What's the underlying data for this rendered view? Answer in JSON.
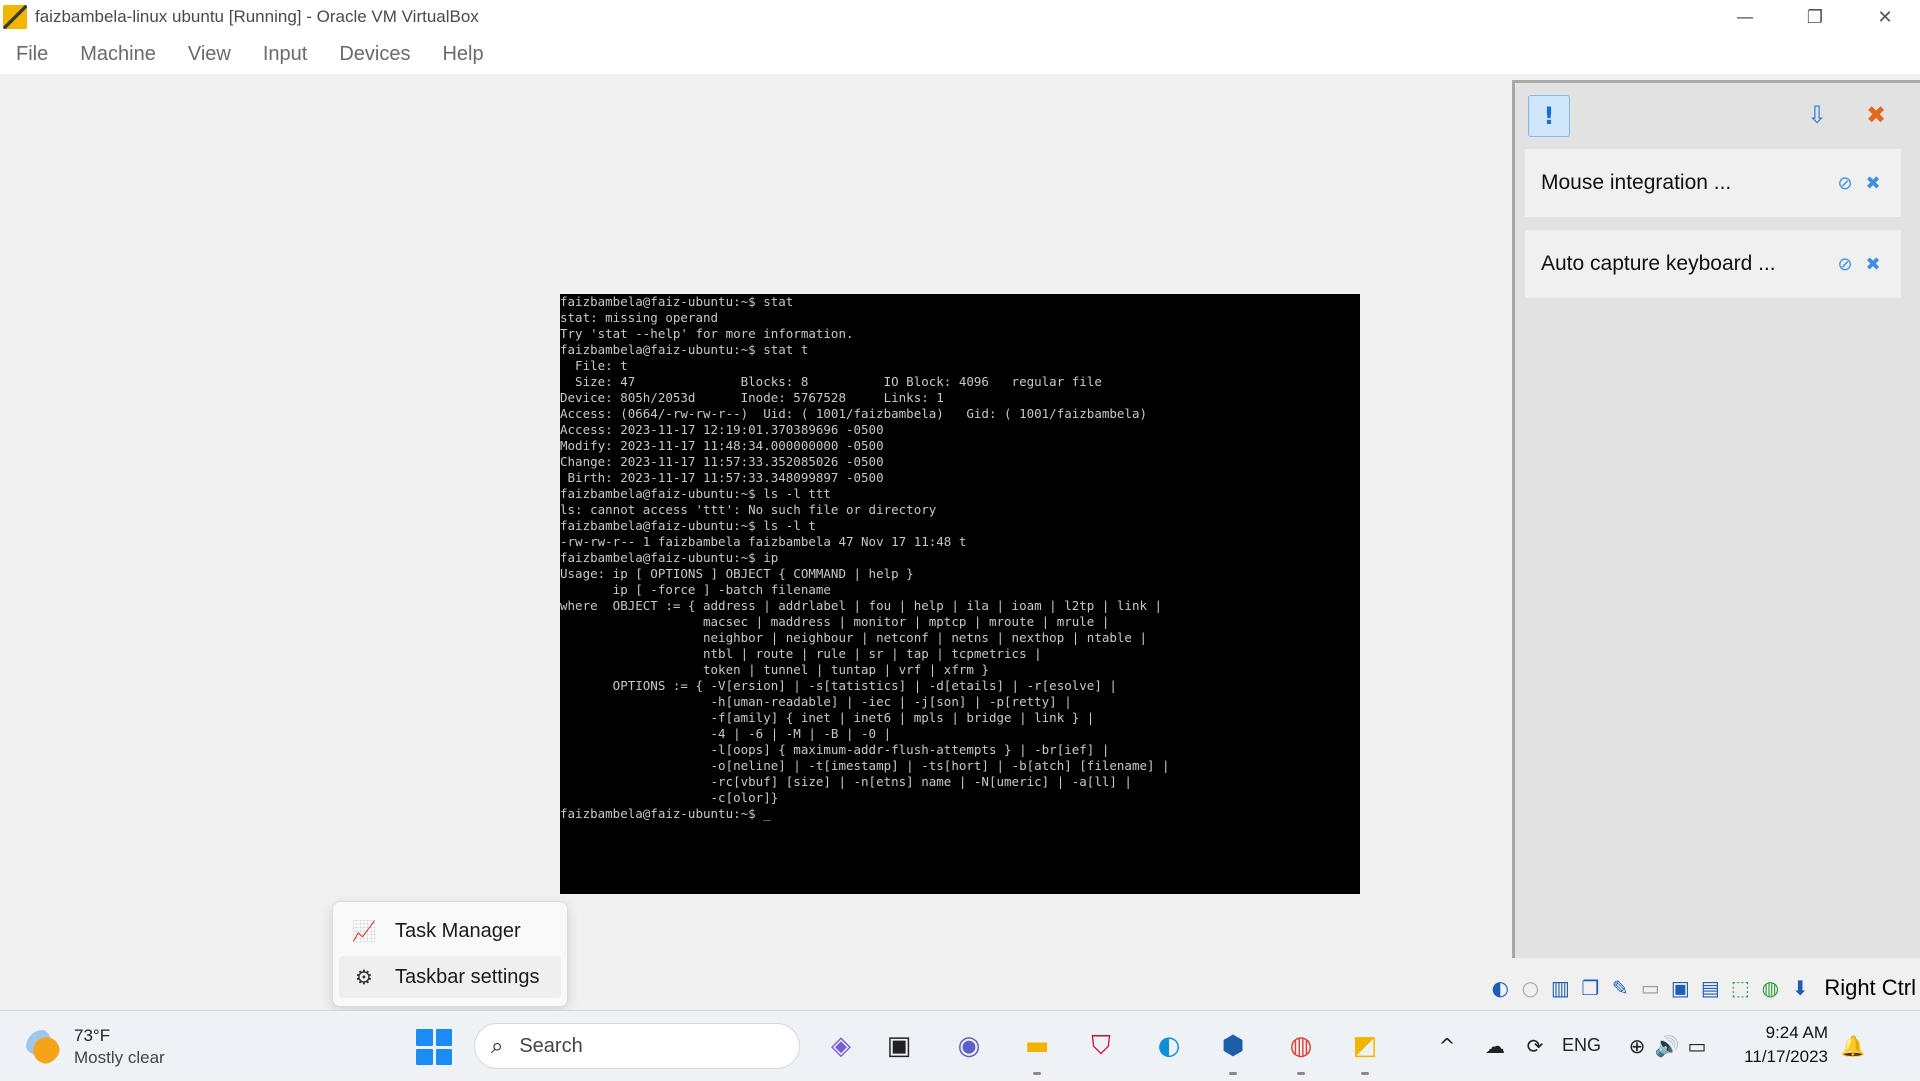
{
  "window": {
    "title": "faizbambela-linux ubuntu [Running] - Oracle VM VirtualBox",
    "minimize": "—",
    "maximize": "❐",
    "close": "✕"
  },
  "menu": {
    "items": [
      "File",
      "Machine",
      "View",
      "Input",
      "Devices",
      "Help"
    ]
  },
  "terminal": {
    "lines": [
      "faizbambela@faiz-ubuntu:~$ stat",
      "stat: missing operand",
      "Try 'stat --help' for more information.",
      "faizbambela@faiz-ubuntu:~$ stat t",
      "  File: t",
      "  Size: 47              Blocks: 8          IO Block: 4096   regular file",
      "Device: 805h/2053d      Inode: 5767528     Links: 1",
      "Access: (0664/-rw-rw-r--)  Uid: ( 1001/faizbambela)   Gid: ( 1001/faizbambela)",
      "Access: 2023-11-17 12:19:01.370389696 -0500",
      "Modify: 2023-11-17 11:48:34.000000000 -0500",
      "Change: 2023-11-17 11:57:33.352085026 -0500",
      " Birth: 2023-11-17 11:57:33.348099897 -0500",
      "faizbambela@faiz-ubuntu:~$ ls -l ttt",
      "ls: cannot access 'ttt': No such file or directory",
      "faizbambela@faiz-ubuntu:~$ ls -l t",
      "-rw-rw-r-- 1 faizbambela faizbambela 47 Nov 17 11:48 t",
      "faizbambela@faiz-ubuntu:~$ ip",
      "Usage: ip [ OPTIONS ] OBJECT { COMMAND | help }",
      "       ip [ -force ] -batch filename",
      "where  OBJECT := { address | addrlabel | fou | help | ila | ioam | l2tp | link |",
      "                   macsec | maddress | monitor | mptcp | mroute | mrule |",
      "                   neighbor | neighbour | netconf | netns | nexthop | ntable |",
      "                   ntbl | route | rule | sr | tap | tcpmetrics |",
      "                   token | tunnel | tuntap | vrf | xfrm }",
      "       OPTIONS := { -V[ersion] | -s[tatistics] | -d[etails] | -r[esolve] |",
      "                    -h[uman-readable] | -iec | -j[son] | -p[retty] |",
      "                    -f[amily] { inet | inet6 | mpls | bridge | link } |",
      "                    -4 | -6 | -M | -B | -0 |",
      "                    -l[oops] { maximum-addr-flush-attempts } | -br[ief] |",
      "                    -o[neline] | -t[imestamp] | -ts[hort] | -b[atch] [filename] |",
      "                    -rc[vbuf] [size] | -n[etns] name | -N[umeric] | -a[ll] |",
      "                    -c[olor]}",
      "faizbambela@faiz-ubuntu:~$ _"
    ]
  },
  "notifications": {
    "toolbar": {
      "notif_icon": "!",
      "sort_icon": "⇩",
      "close_all_icon": "✖"
    },
    "cards": [
      {
        "text": "Mouse integration ...",
        "mute_icon": "⊘",
        "close_icon": "✖"
      },
      {
        "text": "Auto capture keyboard ...",
        "mute_icon": "⊘",
        "close_icon": "✖"
      }
    ]
  },
  "statusbar": {
    "icons": [
      "◐",
      "○",
      "▥",
      "❐",
      "✎",
      "▭",
      "▣",
      "▤",
      "⬚",
      "◍",
      "⬇"
    ],
    "host_key": "Right Ctrl"
  },
  "context_menu": {
    "items": [
      {
        "icon": "📈",
        "label": "Task Manager"
      },
      {
        "icon": "⚙",
        "label": "Taskbar settings"
      }
    ]
  },
  "taskbar": {
    "weather": {
      "temp": "73°F",
      "desc": "Mostly clear"
    },
    "search": {
      "placeholder": "Search",
      "icon": "⌕"
    },
    "apps": [
      {
        "name": "copilot-pre-icon",
        "icon": "◈",
        "color": "#7b5cd6"
      },
      {
        "name": "task-view-icon",
        "icon": "▣",
        "color": "#222222"
      },
      {
        "name": "teams-chat-icon",
        "icon": "◉",
        "color": "#5b5fc7"
      },
      {
        "name": "file-explorer-icon",
        "icon": "▬",
        "color": "#f2b300"
      },
      {
        "name": "mcafee-icon",
        "icon": "⛉",
        "color": "#c8102e"
      },
      {
        "name": "edge-icon",
        "icon": "◐",
        "color": "#0f8fd6"
      },
      {
        "name": "virtualbox-icon",
        "icon": "⬢",
        "color": "#1c5fa8"
      },
      {
        "name": "chrome-icon",
        "icon": "◍",
        "color": "#db4437"
      },
      {
        "name": "virtualbox-vm-icon",
        "icon": "◩",
        "color": "#f2b600"
      }
    ],
    "tray": {
      "chevron": "^",
      "onedrive": "☁",
      "sync": "⟳",
      "lang": "ENG",
      "network": "⊕",
      "volume": "🔊",
      "battery": "▭",
      "bell": "🔔"
    },
    "clock": {
      "time": "9:24 AM",
      "date": "11/17/2023"
    }
  }
}
